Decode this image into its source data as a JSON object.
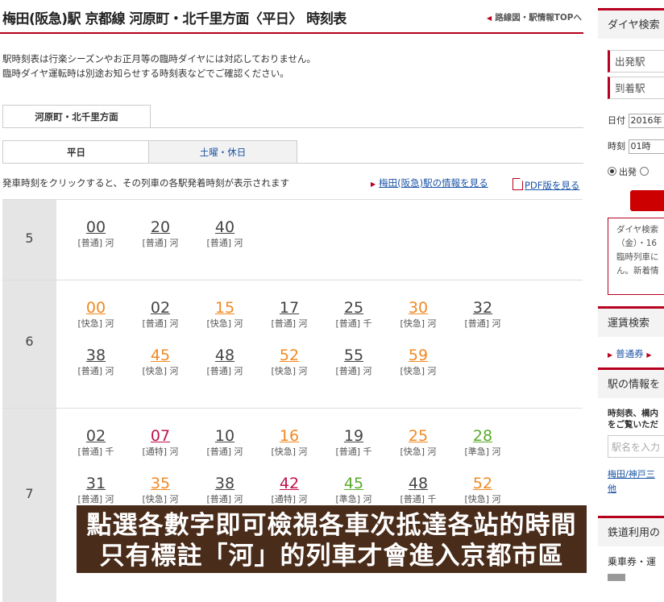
{
  "header": {
    "title": "梅田(阪急)駅 京都線 河原町・北千里方面〈平日〉 時刻表",
    "top_link": "路線図・駅情報TOPへ"
  },
  "notice": {
    "line1": "駅時刻表は行楽シーズンやお正月等の臨時ダイヤには対応しておりません。",
    "line2": "臨時ダイヤ運転時は別途お知らせする時刻表などでご確認ください。"
  },
  "tabs": {
    "direction": "河原町・北千里方面",
    "weekday": "平日",
    "holiday": "土曜・休日"
  },
  "info": {
    "click_hint": "発車時刻をクリックすると、その列車の各駅発着時刻が表示されます",
    "station_info_link": "梅田(阪急)駅の情報を見る",
    "pdf_link": "PDF版を見る"
  },
  "colors": {
    "普通": "#444444",
    "快急": "#f08a24",
    "通特": "#c0124a",
    "準急": "#5aab2a",
    "accent": "#b7001e",
    "link": "#1a53a6"
  },
  "timetable": [
    {
      "hour": "5",
      "departures": [
        {
          "min": "00",
          "type": "普通",
          "dest": "河"
        },
        {
          "min": "20",
          "type": "普通",
          "dest": "河"
        },
        {
          "min": "40",
          "type": "普通",
          "dest": "河"
        }
      ]
    },
    {
      "hour": "6",
      "departures": [
        {
          "min": "00",
          "type": "快急",
          "dest": "河"
        },
        {
          "min": "02",
          "type": "普通",
          "dest": "河"
        },
        {
          "min": "15",
          "type": "快急",
          "dest": "河"
        },
        {
          "min": "17",
          "type": "普通",
          "dest": "河"
        },
        {
          "min": "25",
          "type": "普通",
          "dest": "千"
        },
        {
          "min": "30",
          "type": "快急",
          "dest": "河"
        },
        {
          "min": "32",
          "type": "普通",
          "dest": "河"
        },
        {
          "min": "38",
          "type": "普通",
          "dest": "河"
        },
        {
          "min": "45",
          "type": "快急",
          "dest": "河"
        },
        {
          "min": "48",
          "type": "普通",
          "dest": "河"
        },
        {
          "min": "52",
          "type": "快急",
          "dest": "河"
        },
        {
          "min": "55",
          "type": "普通",
          "dest": "河"
        },
        {
          "min": "59",
          "type": "快急",
          "dest": "河"
        }
      ]
    },
    {
      "hour": "7",
      "departures": [
        {
          "min": "02",
          "type": "普通",
          "dest": "千"
        },
        {
          "min": "07",
          "type": "通特",
          "dest": "河"
        },
        {
          "min": "10",
          "type": "普通",
          "dest": "河"
        },
        {
          "min": "16",
          "type": "快急",
          "dest": "河"
        },
        {
          "min": "19",
          "type": "普通",
          "dest": "千"
        },
        {
          "min": "25",
          "type": "快急",
          "dest": "河"
        },
        {
          "min": "28",
          "type": "準急",
          "dest": "河"
        },
        {
          "min": "31",
          "type": "普通",
          "dest": "河"
        },
        {
          "min": "35",
          "type": "快急",
          "dest": "河"
        },
        {
          "min": "38",
          "type": "普通",
          "dest": "河"
        },
        {
          "min": "42",
          "type": "通特",
          "dest": "河"
        },
        {
          "min": "45",
          "type": "準急",
          "dest": "河"
        },
        {
          "min": "48",
          "type": "普通",
          "dest": "千"
        },
        {
          "min": "52",
          "type": "快急",
          "dest": "河"
        }
      ]
    }
  ],
  "sidebar": {
    "dia_title": "ダイヤ検索",
    "from": "出発駅",
    "to": "到着駅",
    "date_label": "日付",
    "date_value": "2016年",
    "time_label": "時刻",
    "time_value": "01時",
    "radio_depart": "出発",
    "note1": "ダイヤ検索",
    "note2": "（金）・16",
    "note3": "臨時列車に",
    "note4": "ん。新着情",
    "fare_title": "運賃検索",
    "fare_link": "普通券",
    "station_info_title": "駅の情報を",
    "station_info_text1": "時刻表、構内",
    "station_info_text2": "をご覧いただ",
    "search_placeholder": "駅名を入力",
    "st_link1": "梅田/神戸三",
    "st_link2": "他",
    "rail_use_title": "鉄道利用の",
    "ticket_title": "乗車券・運"
  },
  "overlay": {
    "line1": "點選各數字即可檢視各車次抵達各站的時間",
    "line2": "只有標註「河」的列車才會進入京都市區"
  }
}
